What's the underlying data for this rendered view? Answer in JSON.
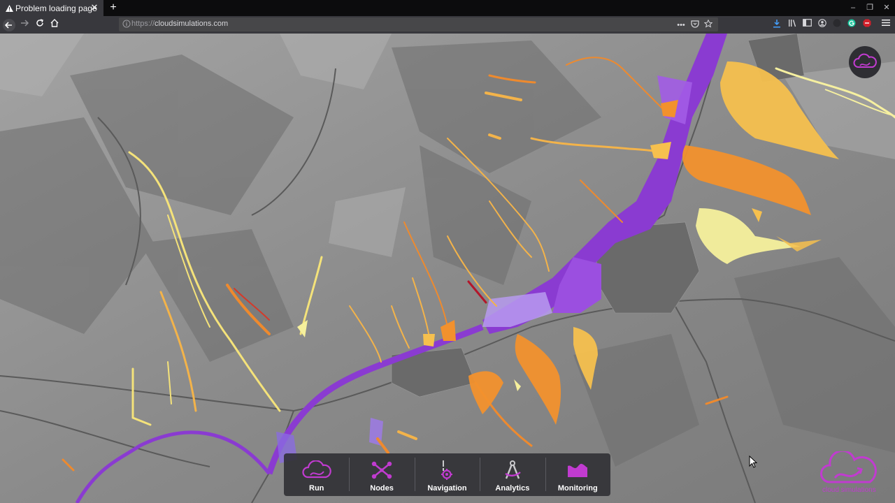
{
  "browser": {
    "tab_title": "Problem loading page",
    "tab_close": "✕",
    "new_tab": "+",
    "window_controls": [
      "–",
      "❐",
      "✕"
    ],
    "url_protocol": "https://",
    "url_host": "cloudsimulations.com",
    "page_actions": "•••"
  },
  "app": {
    "brand_name": "cloud simulations",
    "accent_color": "#c13bd0",
    "toolbar": [
      {
        "label": "Run",
        "icon": "cloud-run-icon"
      },
      {
        "label": "Nodes",
        "icon": "nodes-network-icon"
      },
      {
        "label": "Navigation",
        "icon": "navigation-pin-icon"
      },
      {
        "label": "Analytics",
        "icon": "analytics-compass-icon"
      },
      {
        "label": "Monitoring",
        "icon": "monitoring-area-chart-icon"
      }
    ]
  }
}
